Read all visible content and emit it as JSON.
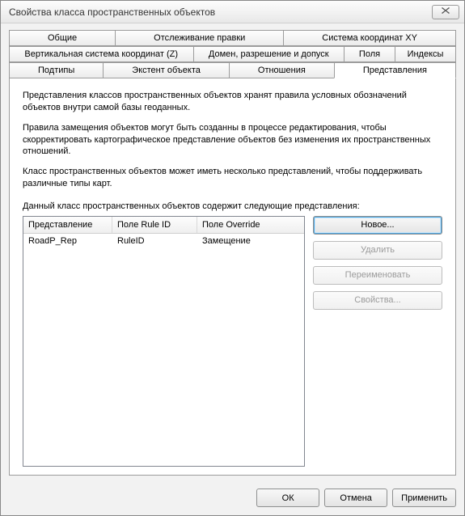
{
  "window": {
    "title": "Свойства класса пространственных объектов"
  },
  "tabs": {
    "row1": [
      "Общие",
      "Отслеживание правки",
      "Система координат XY"
    ],
    "row2": [
      "Вертикальная система координат (Z)",
      "Домен, разрешение и допуск",
      "Поля",
      "Индексы"
    ],
    "row3": [
      "Подтипы",
      "Экстент объекта",
      "Отношения",
      "Представления"
    ],
    "active": "Представления"
  },
  "desc": {
    "p1": "Представления классов пространственных объектов хранят правила условных обозначений объектов внутри самой базы геоданных.",
    "p2": "Правила замещения объектов могут быть созданны в процессе редактирования, чтобы скорректировать картографическое представление объектов без изменения их пространственных отношений.",
    "p3": "Класс пространственных объектов может иметь несколько представлений, чтобы поддерживать различные типы карт.",
    "listLabel": "Данный класс пространственных объектов содержит следующие представления:"
  },
  "list": {
    "columns": [
      "Представление",
      "Поле Rule ID",
      "Поле Override"
    ],
    "rows": [
      {
        "name": "RoadP_Rep",
        "ruleId": "RuleID",
        "override": "Замещение"
      }
    ]
  },
  "sideButtons": {
    "new": "Новое...",
    "delete": "Удалить",
    "rename": "Переименовать",
    "props": "Свойства..."
  },
  "footer": {
    "ok": "ОК",
    "cancel": "Отмена",
    "apply": "Применить"
  }
}
